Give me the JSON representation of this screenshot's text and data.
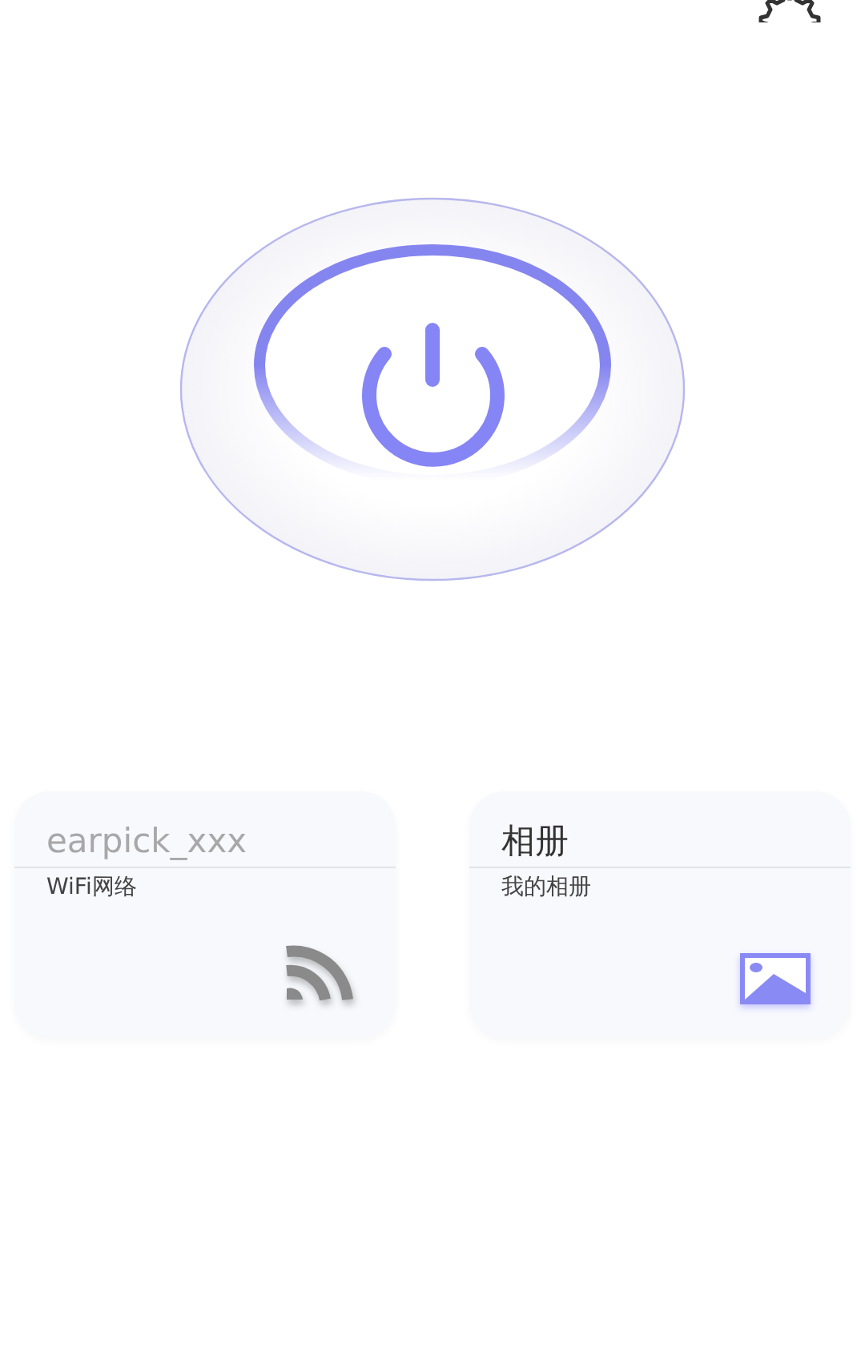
{
  "cards": [
    {
      "kind": "wifi",
      "title": "earpick_xxx",
      "subtitle": "WiFi网络"
    },
    {
      "kind": "album",
      "title": "相册",
      "subtitle": "我的相册"
    }
  ]
}
